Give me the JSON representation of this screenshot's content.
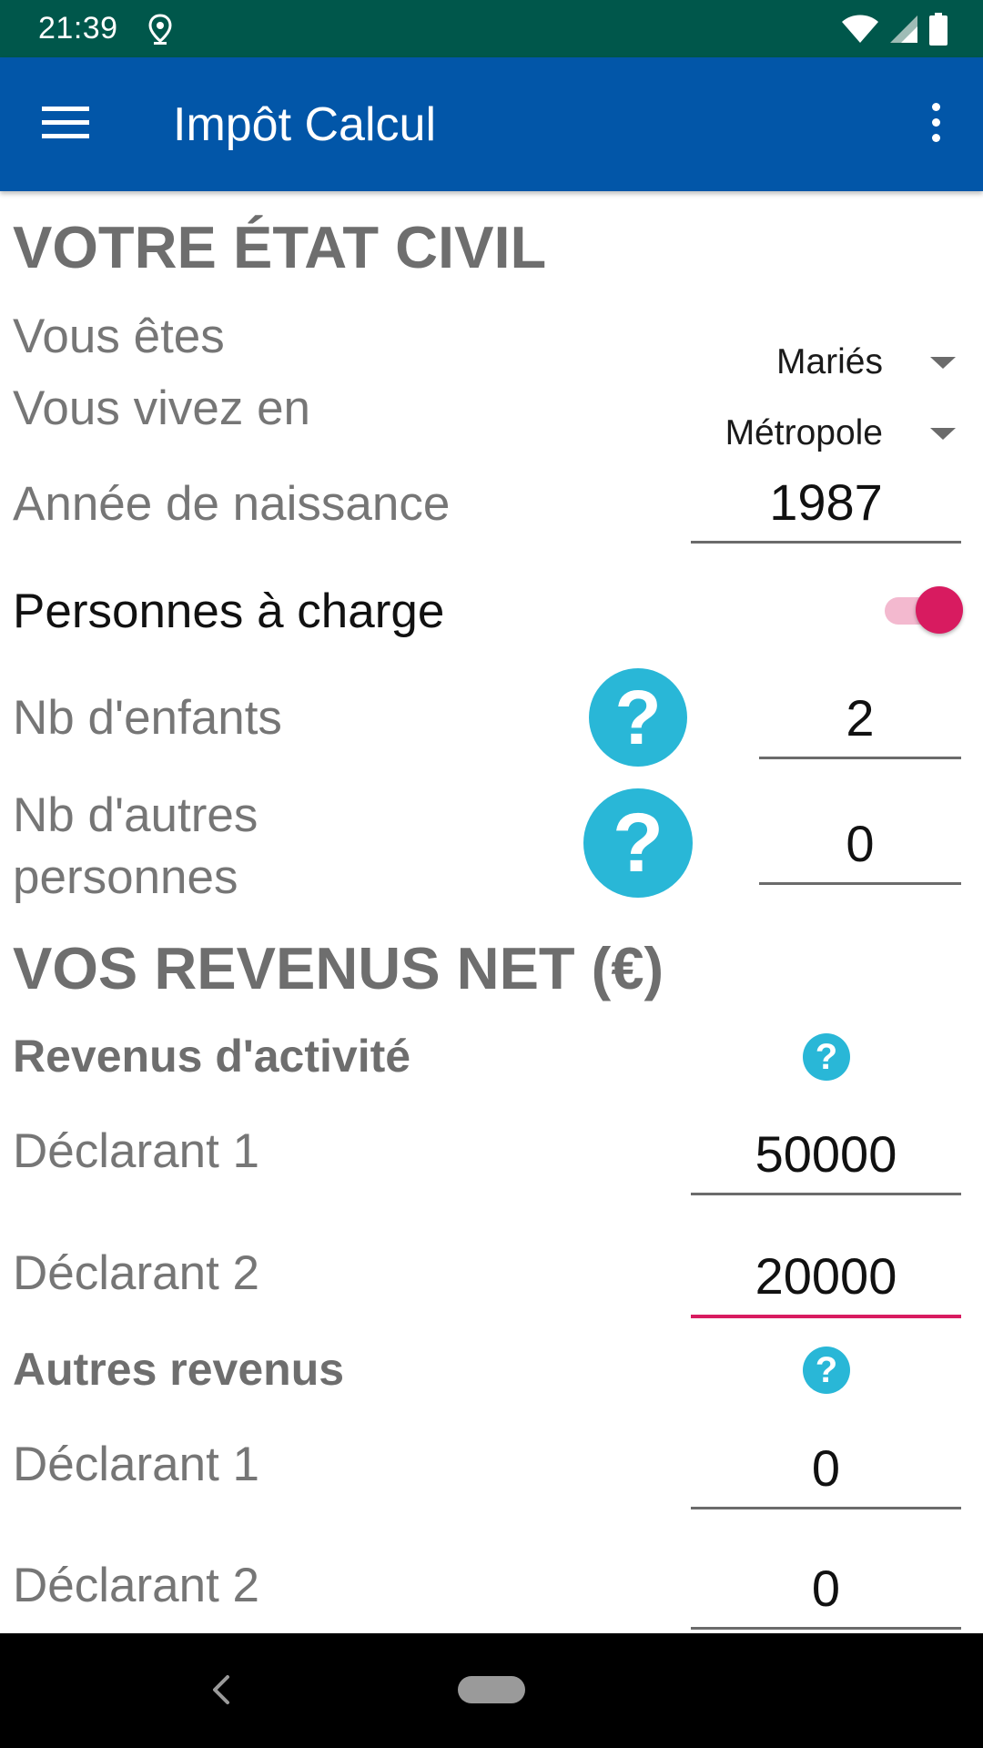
{
  "status_bar": {
    "time": "21:39",
    "icons": [
      "location-icon",
      "wifi-icon",
      "signal-icon",
      "battery-icon"
    ]
  },
  "app_bar": {
    "title": "Impôt Calcul",
    "menu_icon": "hamburger-menu-icon",
    "overflow_icon": "more-vertical-icon"
  },
  "etat_civil": {
    "title": "VOTRE ÉTAT CIVIL",
    "situation": {
      "label": "Vous êtes",
      "value": "Mariés"
    },
    "residence": {
      "label": "Vous vivez en",
      "value": "Métropole"
    },
    "birth_year": {
      "label": "Année de naissance",
      "value": "1987"
    },
    "dependents": {
      "label": "Personnes à charge",
      "enabled": true
    },
    "children": {
      "label": "Nb d'enfants",
      "value": "2",
      "help": "?"
    },
    "others": {
      "label_line1": "Nb d'autres",
      "label_line2": "personnes",
      "value": "0",
      "help": "?"
    }
  },
  "revenus": {
    "title": "VOS REVENUS NET (€)",
    "activite": {
      "title": "Revenus d'activité",
      "help": "?",
      "declarant1": {
        "label": "Déclarant 1",
        "value": "50000"
      },
      "declarant2": {
        "label": "Déclarant 2",
        "value": "20000"
      }
    },
    "autres": {
      "title": "Autres revenus",
      "help": "?",
      "declarant1": {
        "label": "Déclarant 1",
        "value": "0"
      },
      "declarant2": {
        "label": "Déclarant 2",
        "value": "0"
      }
    }
  },
  "colors": {
    "status_bar": "#00574b",
    "app_bar": "#0256a8",
    "accent": "#d81b60",
    "help_button": "#29b7d7",
    "section_text": "#6e6e6e"
  },
  "nav_bar": {
    "back_icon": "back-arrow-icon",
    "home_icon": "home-pill-icon"
  }
}
